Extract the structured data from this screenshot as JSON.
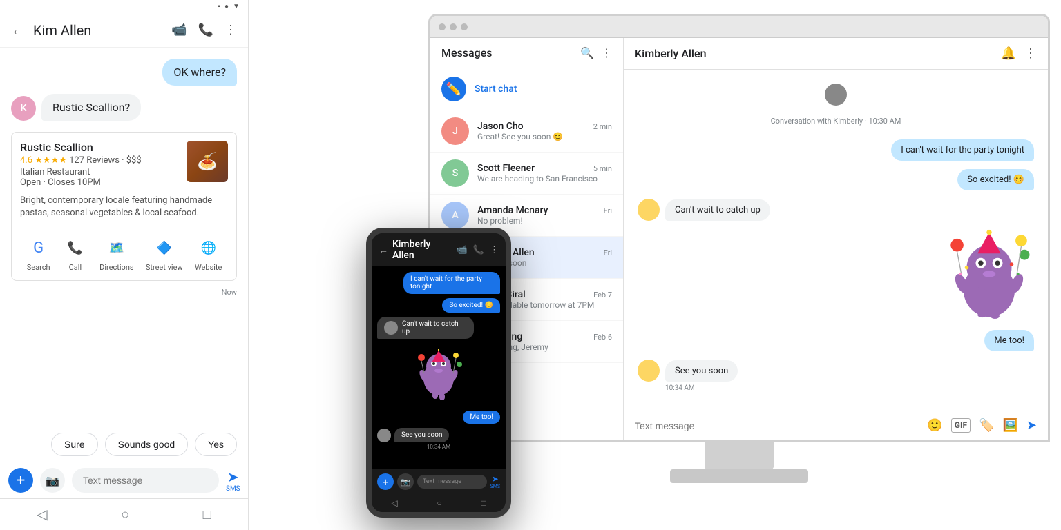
{
  "left_phone": {
    "contact_name": "Kim Allen",
    "messages": [
      {
        "type": "sent",
        "text": "OK where?"
      },
      {
        "type": "received_text",
        "text": "Rustic Scallion?"
      },
      {
        "type": "card",
        "title": "Rustic Scallion",
        "rating": "4.6",
        "stars": "★★★★",
        "reviews": "127 Reviews",
        "price": "$$$",
        "category": "Italian Restaurant",
        "hours": "Open · Closes 10PM",
        "description": "Bright, contemporary locale featuring handmade pastas, seasonal vegetables & local seafood."
      },
      {
        "type": "timestamp",
        "text": "Now"
      },
      {
        "type": "smart_replies",
        "options": [
          "Sure",
          "Sounds good",
          "Yes"
        ]
      }
    ],
    "input_placeholder": "Text message",
    "actions": [
      "Search",
      "Call",
      "Directions",
      "Street view",
      "Website"
    ]
  },
  "center_phone": {
    "contact_name": "Kimberly Allen",
    "messages": [
      {
        "type": "sent",
        "text": "I can't wait for the party tonight"
      },
      {
        "type": "sent",
        "text": "So excited! 😊"
      },
      {
        "type": "received",
        "text": "Can't wait to catch up"
      },
      {
        "type": "sent",
        "text": "Me too!"
      }
    ],
    "see_soon": "See you soon",
    "see_soon_time": "10:34 AM",
    "input_placeholder": "Text message"
  },
  "desktop": {
    "app_title": "Messages",
    "chat_with": "Kimberly Allen",
    "conv_label": "Conversation with Kimberly · 10:30 AM",
    "sidebar_items": [
      {
        "name": "Jason Cho",
        "preview": "Great! See you soon 😊",
        "time": "2 min",
        "avatar_color": "#f28b82"
      },
      {
        "name": "Scott Fleener",
        "preview": "We are heading to San Francisco",
        "time": "5 min",
        "avatar_color": "#81c995"
      },
      {
        "name": "Amanda Mcnary",
        "preview": "No problem!",
        "time": "Fri",
        "avatar_color": "#a8c7fa"
      },
      {
        "name": "Kimerly Allen",
        "preview": "See you soon",
        "time": "Fri",
        "avatar_color": "#fdd663"
      },
      {
        "name": "Julien Biral",
        "preview": "I am available tomorrow at 7PM",
        "time": "Feb 7",
        "avatar_color": "#ff8bcb"
      },
      {
        "name": "y Planning",
        "preview": "is amazing, Jeremy",
        "time": "Feb 6",
        "avatar_color": "#8ab4f8"
      }
    ],
    "start_chat_label": "Start chat",
    "messages": [
      {
        "type": "sent",
        "text": "I can't wait for the party tonight"
      },
      {
        "type": "sent",
        "text": "So excited! 😊"
      },
      {
        "type": "received",
        "text": "Can't wait to catch up"
      },
      {
        "type": "sticker"
      },
      {
        "type": "sent",
        "text": "Me too!"
      }
    ],
    "see_soon": "See you soon",
    "see_soon_time": "10:34 AM",
    "input_placeholder": "Text message"
  }
}
